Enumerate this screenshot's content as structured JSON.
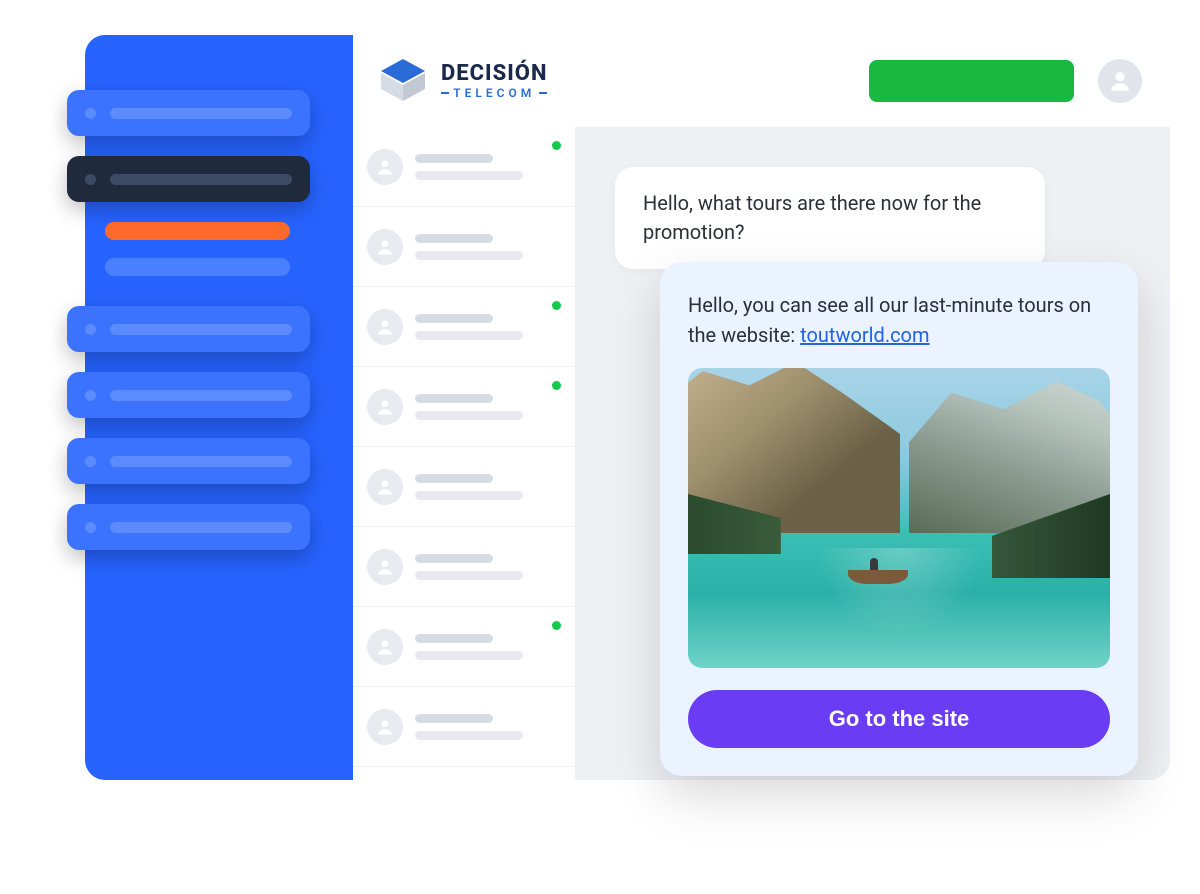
{
  "brand": {
    "name_line1": "DECISIÓN",
    "name_line2": "TELECOM"
  },
  "header": {
    "cta_label": "",
    "avatar_icon": "user-icon"
  },
  "sidebar": {
    "items": [
      {
        "type": "nav",
        "variant": "blue"
      },
      {
        "type": "nav",
        "variant": "dark",
        "active": true
      },
      {
        "type": "sub",
        "color": "orange"
      },
      {
        "type": "sub",
        "color": "blue"
      },
      {
        "type": "nav",
        "variant": "blue"
      },
      {
        "type": "nav",
        "variant": "blue"
      },
      {
        "type": "nav",
        "variant": "blue"
      },
      {
        "type": "nav",
        "variant": "blue"
      }
    ]
  },
  "contacts": [
    {
      "online": true
    },
    {
      "online": false
    },
    {
      "online": true
    },
    {
      "online": true
    },
    {
      "online": false
    },
    {
      "online": false
    },
    {
      "online": true
    },
    {
      "online": false
    }
  ],
  "chat": {
    "incoming_message": "Hello, what tours are there now for the promotion?",
    "response_prefix": "Hello, you can see all our last-minute tours on the website: ",
    "response_link_text": "toutworld.com",
    "cta_button": "Go to the site",
    "image_alt": "mountain-lake-scenery"
  },
  "colors": {
    "sidebar": "#2663ff",
    "accent_orange": "#ff6a2b",
    "cta_green": "#18b93e",
    "button_purple": "#6a3df5",
    "response_bg": "#eaf3ff"
  }
}
